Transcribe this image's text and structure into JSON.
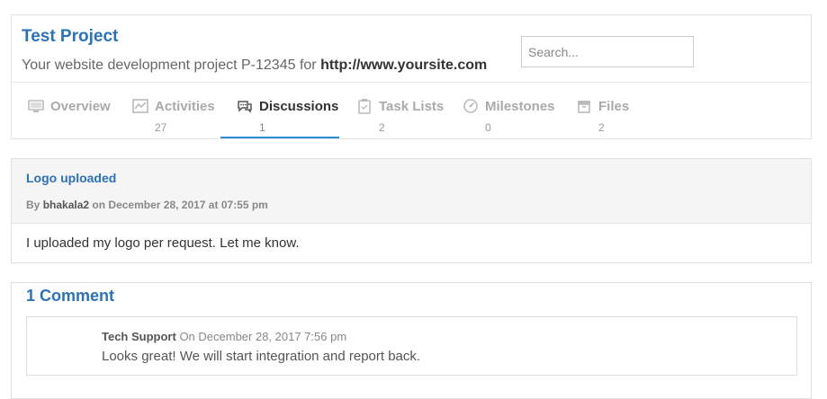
{
  "project": {
    "title": "Test Project",
    "description_prefix": "Your website development project P-12345 for ",
    "url": "http://www.yoursite.com"
  },
  "search": {
    "placeholder": "Search..."
  },
  "tabs": [
    {
      "label": "Overview",
      "count": "",
      "icon": "monitor-icon"
    },
    {
      "label": "Activities",
      "count": "27",
      "icon": "activity-chart-icon"
    },
    {
      "label": "Discussions",
      "count": "1",
      "icon": "chat-bubbles-icon"
    },
    {
      "label": "Task Lists",
      "count": "2",
      "icon": "clipboard-icon"
    },
    {
      "label": "Milestones",
      "count": "0",
      "icon": "gauge-icon"
    },
    {
      "label": "Files",
      "count": "2",
      "icon": "archive-icon"
    }
  ],
  "active_tab": "Discussions",
  "discussion": {
    "title": "Logo uploaded",
    "by": "By",
    "author": "bhakala2",
    "date": "on December 28, 2017 at 07:55 pm",
    "body": "I uploaded my logo per request. Let me know."
  },
  "comments": {
    "heading": "1 Comment",
    "items": [
      {
        "author": "Tech Support",
        "date": "On December 28, 2017 7:56 pm",
        "text": "Looks great! We will start integration and report back."
      }
    ]
  },
  "colors": {
    "accent": "#2b72b8",
    "tab_underline": "#2b8cd6"
  }
}
